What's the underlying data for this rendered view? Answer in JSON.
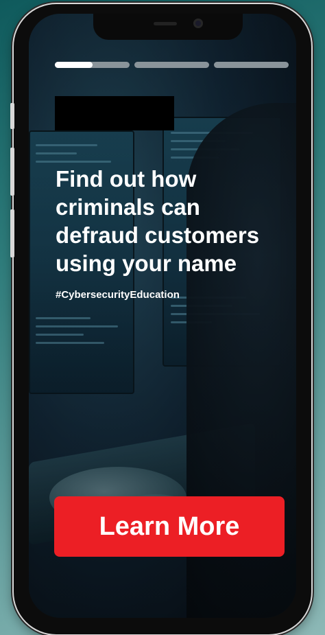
{
  "story": {
    "progress_segments": [
      {
        "label": "segment-1",
        "fill": 0.5
      },
      {
        "label": "segment-2",
        "fill": 0
      },
      {
        "label": "segment-3",
        "fill": 0
      }
    ],
    "headline": "Find out how criminals can defraud customers using your name",
    "hashtag": "#CybersecurityEducation",
    "cta_label": "Learn More"
  },
  "colors": {
    "cta_background": "#ec1f25",
    "progress_active": "#ffffff",
    "progress_inactive": "#8a949a"
  }
}
